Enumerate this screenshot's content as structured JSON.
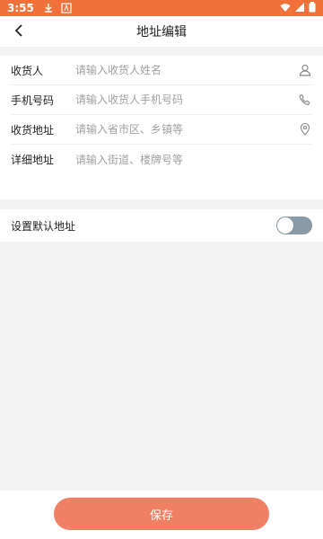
{
  "status_bar": {
    "time": "3:55"
  },
  "header": {
    "title": "地址编辑"
  },
  "form": {
    "fields": [
      {
        "label": "收货人",
        "placeholder": "请输入收货人姓名",
        "value": "",
        "icon": "person-icon"
      },
      {
        "label": "手机号码",
        "placeholder": "请输入收货人手机号码",
        "value": "",
        "icon": "phone-icon"
      },
      {
        "label": "收货地址",
        "placeholder": "请输入省市区、乡镇等",
        "value": "",
        "icon": "location-pin-icon"
      },
      {
        "label": "详细地址",
        "placeholder": "请输入街道、楼牌号等",
        "value": ""
      }
    ]
  },
  "default_address": {
    "label": "设置默认地址",
    "enabled": false
  },
  "footer": {
    "save_label": "保存"
  },
  "colors": {
    "accent": "#f0713a",
    "save_button": "#f08063",
    "toggle_off": "#8a9aa6"
  }
}
